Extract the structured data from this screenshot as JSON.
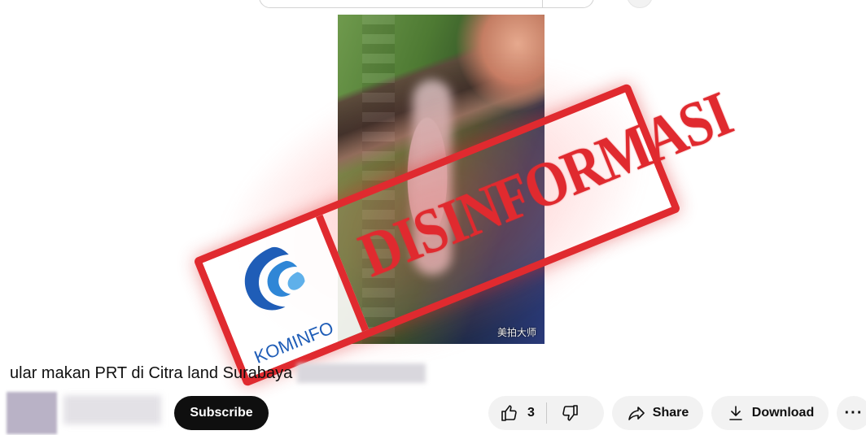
{
  "video": {
    "title": "ular makan PRT di Citra land Surabaya",
    "watermark": "美拍大师"
  },
  "stamp": {
    "word": "DISINFORMASI",
    "logo_text": "KOMINFO",
    "color": "#e02a2f",
    "logo_color": "#1f5db7"
  },
  "channel": {
    "subscribe_label": "Subscribe"
  },
  "actions": {
    "like_count": "3",
    "like_icon": "thumbs-up-icon",
    "dislike_icon": "thumbs-down-icon",
    "share_label": "Share",
    "share_icon": "share-icon",
    "download_label": "Download",
    "download_icon": "download-icon",
    "more_label": "···"
  }
}
